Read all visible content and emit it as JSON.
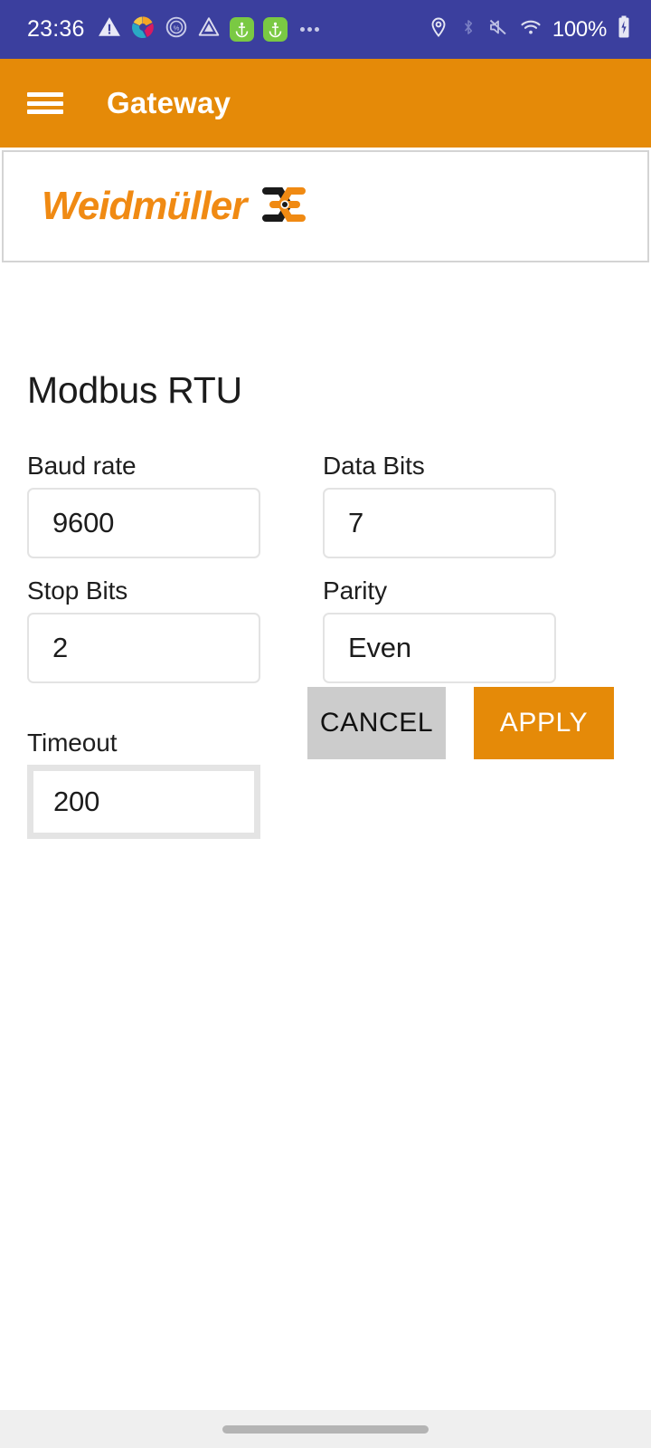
{
  "status_bar": {
    "clock": "23:36",
    "battery_percent": "100%",
    "left_icons": [
      "warning-triangle-icon",
      "pinwheel-app-icon",
      "circle-percent-icon",
      "triangle-drop-icon",
      "anchor-app-icon",
      "anchor-app-icon",
      "more-dots-icon"
    ],
    "right_icons": [
      "location-pin-icon",
      "bluetooth-icon",
      "mute-icon",
      "wifi-icon",
      "battery-icon"
    ],
    "background_color": "#3b3f9e"
  },
  "app_bar": {
    "menu_label": "menu",
    "title": "Gateway",
    "background_color": "#e58a08"
  },
  "brand": {
    "wordmark": "Weidmüller",
    "wordmark_color": "#f08a13",
    "mark_colors": [
      "#1a1a1a",
      "#f08a13"
    ]
  },
  "main": {
    "section_title": "Modbus RTU",
    "fields": [
      {
        "label": "Baud rate",
        "value": "9600",
        "focused": false
      },
      {
        "label": "Data Bits",
        "value": "7",
        "focused": false
      },
      {
        "label": "Stop Bits",
        "value": "2",
        "focused": false
      },
      {
        "label": "Parity",
        "value": "Even",
        "focused": false
      },
      {
        "label": "Timeout",
        "value": "200",
        "focused": true
      }
    ],
    "buttons": {
      "cancel": "CANCEL",
      "apply": "APPLY",
      "cancel_color": "#cccccc",
      "apply_color": "#e58a08"
    }
  },
  "nav_bar": {
    "gesture_pill": "home-gesture-pill"
  }
}
